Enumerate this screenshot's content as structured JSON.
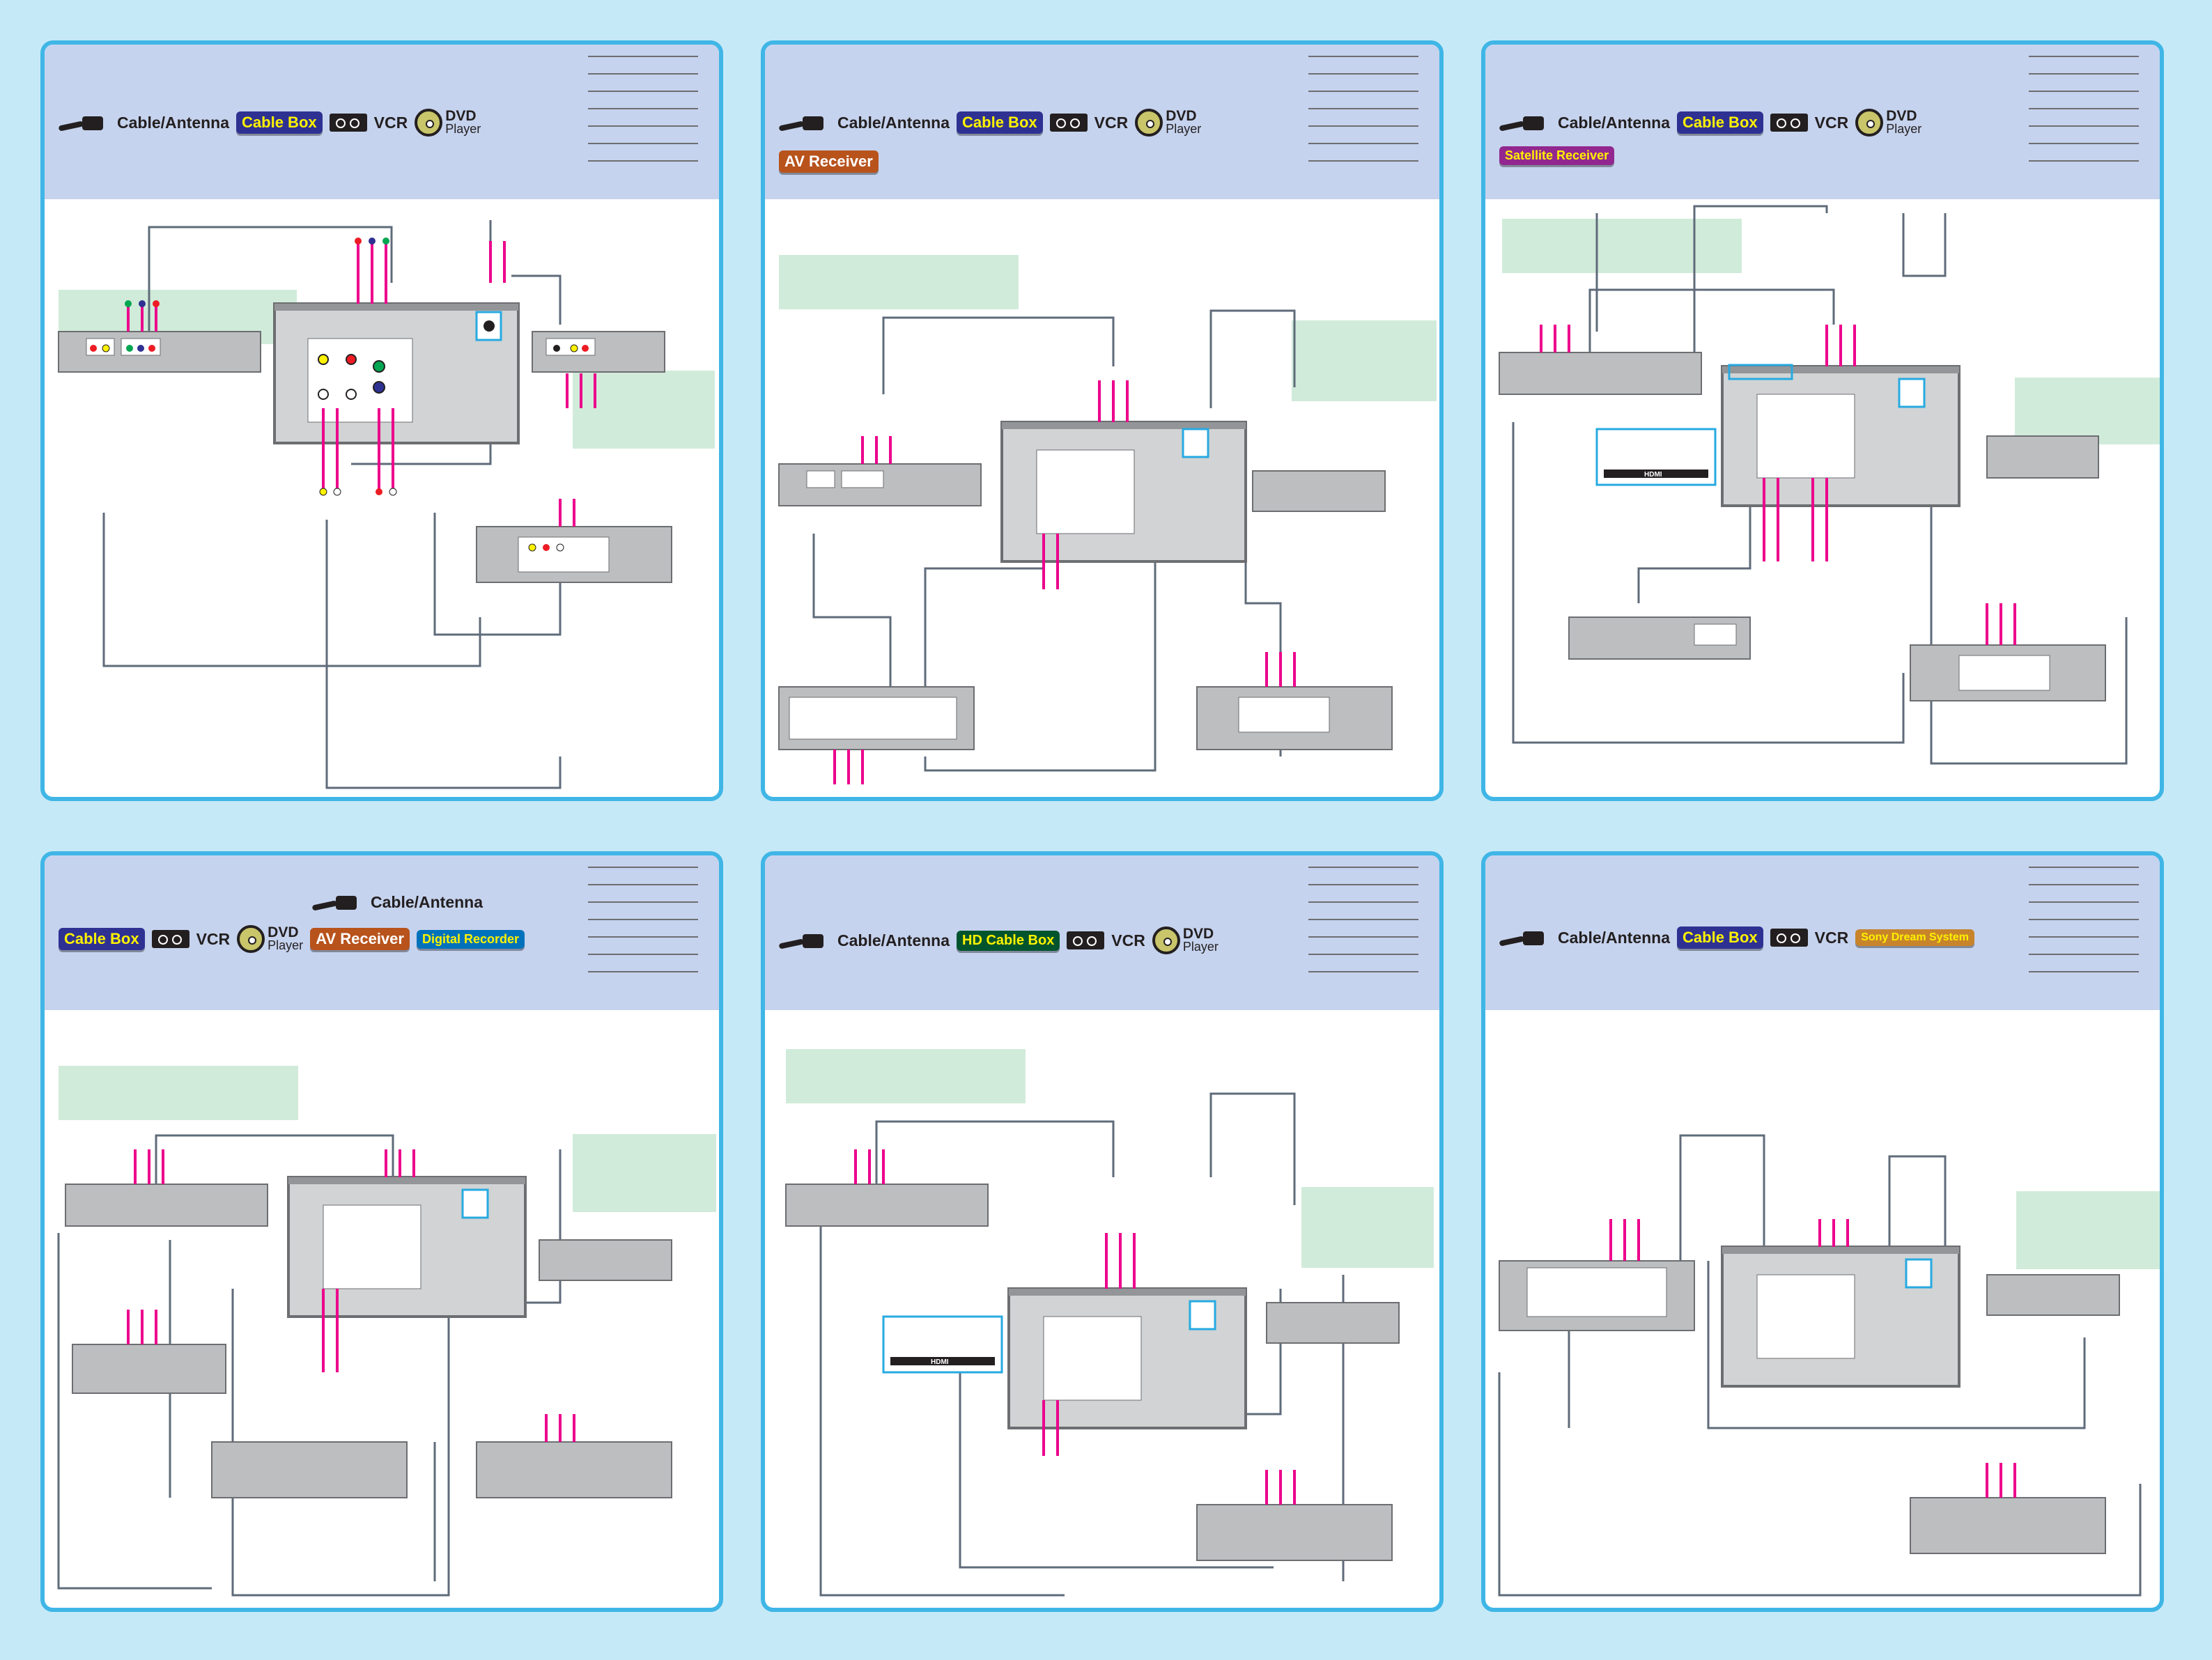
{
  "labels": {
    "cable_antenna": "Cable/Antenna",
    "cable_box": "Cable Box",
    "vcr": "VCR",
    "dvd": "DVD",
    "player": "Player",
    "av_receiver": "AV Receiver",
    "satellite_receiver": "Satellite Receiver",
    "digital_recorder": "Digital Recorder",
    "hd_cable_box": "HD Cable Box",
    "sony_dream_system": "Sony Dream System",
    "hdmi": "HDMI"
  },
  "colors": {
    "background": "#c6e9f7",
    "panel_border": "#3fb6e6",
    "header": "#c6d3ee",
    "note_box": "#d1ebda",
    "cable_wire": "#5f6b7a",
    "connector_pink": "#ec008c",
    "device_gray": "#bcbec0",
    "highlight_blue": "#27aae1",
    "video_yellow": "#fff200",
    "audio_red": "#ed1c24",
    "audio_white": "#ffffff",
    "comp_green": "#00a651",
    "comp_blue": "#2e3192",
    "comp_red": "#ed1c24"
  },
  "panels": [
    {
      "id": "p1",
      "badges": [
        "cable_antenna",
        "cable_box",
        "vcr",
        "dvd"
      ]
    },
    {
      "id": "p2",
      "badges": [
        "cable_antenna",
        "cable_box",
        "vcr",
        "dvd",
        "av_receiver"
      ]
    },
    {
      "id": "p3",
      "badges": [
        "cable_antenna",
        "cable_box",
        "vcr",
        "dvd",
        "satellite_receiver"
      ]
    },
    {
      "id": "p4",
      "badges": [
        "cable_antenna",
        "cable_box",
        "vcr",
        "dvd",
        "av_receiver",
        "digital_recorder"
      ]
    },
    {
      "id": "p5",
      "badges": [
        "cable_antenna",
        "hd_cable_box",
        "vcr",
        "dvd"
      ]
    },
    {
      "id": "p6",
      "badges": [
        "cable_antenna",
        "cable_box",
        "vcr",
        "sony_dream_system"
      ]
    }
  ]
}
